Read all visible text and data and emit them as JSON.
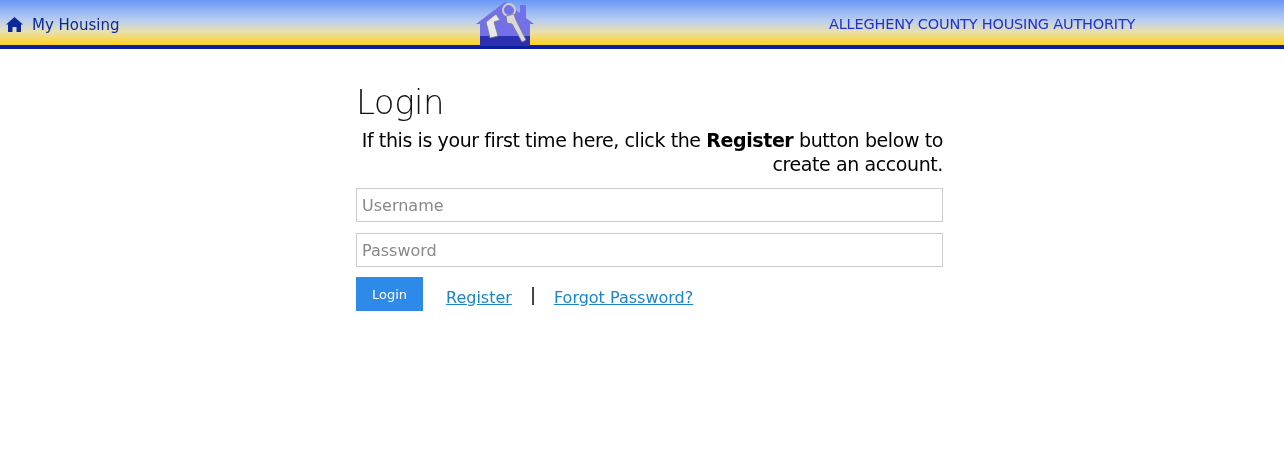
{
  "header": {
    "home_link": "My Housing",
    "agency": "ALLEGHENY COUNTY HOUSING AUTHORITY"
  },
  "login": {
    "title": "Login",
    "intro": "If this is your first time here, click the **Register** button below to create an account.",
    "username": {
      "placeholder": "Username"
    },
    "password": {
      "placeholder": "Password"
    },
    "submit": "Login",
    "register": "Register",
    "separator": "|",
    "forgot": "Forgot Password?"
  }
}
